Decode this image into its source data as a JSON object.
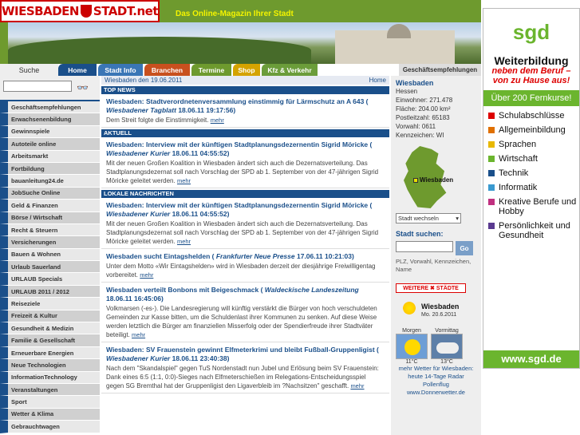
{
  "header": {
    "logo_left": "WIESBADEN",
    "logo_right": "STADT.net",
    "tagline": "Das Online-Magazin Ihrer Stadt"
  },
  "nav": {
    "search_label": "Suche",
    "tabs": [
      {
        "label": "Home",
        "color": "#1a4f8a"
      },
      {
        "label": "Stadt Info",
        "color": "#3a76b6"
      },
      {
        "label": "Branchen",
        "color": "#c8501e"
      },
      {
        "label": "Termine",
        "color": "#6e9a2e"
      },
      {
        "label": "Shop",
        "color": "#d4a300"
      },
      {
        "label": "Kfz & Verkehr",
        "color": "#6b9d3a"
      }
    ],
    "geschaeft": "Geschäftsempfehlungen"
  },
  "sidebar": {
    "search_placeholder": "",
    "items": [
      "Geschäftsempfehlungen",
      "Erwachsenenbildung",
      "Gewinnspiele",
      "Autoteile online",
      "Arbeitsmarkt",
      "Fortbildung",
      "bauanleitung24.de",
      "JobSuche Online",
      "Geld & Finanzen",
      "Börse / Wirtschaft",
      "Recht & Steuern",
      "Versicherungen",
      "Bauen & Wohnen",
      "Urlaub Sauerland",
      "URLAUB Specials",
      "URLAUB 2011 / 2012",
      "Reiseziele",
      "Freizeit & Kultur",
      "Gesundheit & Medizin",
      "Familie & Gesellschaft",
      "Erneuerbare Energien",
      "Neue Technologien",
      "InformationTechnology",
      "Veranstaltungen",
      "Sport",
      "Wetter & Klima",
      "Gebrauchtwagen"
    ]
  },
  "main": {
    "date": "Wiesbaden den 19.06.2011",
    "home_link": "Home",
    "more": "mehr",
    "sections": [
      {
        "title": "TOP NEWS",
        "articles": [
          {
            "head": "Wiesbaden: Stadtverordnetenversammlung einstimmig für Lärmschutz an A 643 (",
            "src": "Wiesbadener Tagblatt",
            "date": "18.06.11 19:17:56)",
            "text": "Dem Streit folgte die Einstimmigkeit."
          }
        ]
      },
      {
        "title": "AKTUELL",
        "articles": [
          {
            "head": "Wiesbaden: Interview mit der künftigen Stadtplanungsdezernentin Sigrid Möricke (",
            "src": "Wiesbadener Kurier",
            "date": "18.06.11 04:55:52)",
            "text": "Mit der neuen Großen Koalition in Wiesbaden ändert sich auch die Dezernatsverteilung. Das Stadtplanungsdezernat soll nach Vorschlag der SPD ab 1. September von der 47-jährigen Sigrid Möricke geleitet werden."
          }
        ]
      },
      {
        "title": "LOKALE NACHRICHTEN",
        "articles": [
          {
            "head": "Wiesbaden: Interview mit der künftigen Stadtplanungsdezernentin Sigrid Möricke (",
            "src": "Wiesbadener Kurier",
            "date": "18.06.11 04:55:52)",
            "text": "Mit der neuen Großen Koalition in Wiesbaden ändert sich auch die Dezernatsverteilung. Das Stadtplanungsdezernat soll nach Vorschlag der SPD ab 1. September von der 47-jährigen Sigrid Möricke geleitet werden."
          },
          {
            "head": "Wiesbaden sucht Eintagshelden (",
            "src": "Frankfurter Neue Presse",
            "date": "17.06.11 10:21:03)",
            "text": "Unter dem Motto «Wir Eintagshelden» wird in Wiesbaden derzeit der diesjährige Freiwilligentag vorbereitet."
          },
          {
            "head": "Wiesbaden verteilt Bonbons mit Beigeschmack (",
            "src": "Waldeckische Landeszeitung",
            "date": "18.06.11 16:45:06)",
            "text": "Volkmarsen (-es-). Die Landesregierung will künftig verstärkt die Bürger von hoch verschuldeten Gemeinden zur Kasse bitten, um die Schuldenlast ihrer Kommunen zu senken. Auf diese Weise werden letztlich die Bürger am finanziellen Misserfolg oder der Spendierfreude ihrer Stadtväter beteiligt."
          },
          {
            "head": "Wiesbaden: SV Frauenstein gewinnt Elfmeterkrimi und bleibt Fußball-Gruppenligist (",
            "src": "Wiesbadener Kurier",
            "date": "18.06.11 23:40:38)",
            "text": "Nach dem \"Skandalspiel\" gegen TuS Nordenstadt nun Jubel und Erlösung beim SV Frauenstein: Dank eines 6:5 (1:1, 0:0)-Sieges nach Elfmeterschießen im Relegations-Entscheidungsspiel gegen SG Bremthal hat der Gruppenligist den Ligaverbleib im ?Nachsitzen\" geschafft."
          }
        ]
      }
    ]
  },
  "info": {
    "city": "Wiesbaden",
    "rows": [
      "Hessen",
      "Einwohner: 271.478",
      "Fläche: 204.00 km²",
      "Postleitzahl: 65183",
      "Vorwahl: 0611",
      "Kennzeichen: WI"
    ],
    "map_label": "Wiesbaden",
    "switch": "Stadt wechseln",
    "search_title": "Stadt suchen:",
    "go": "Go",
    "hint": "PLZ, Vorwahl, Kennzeichen, Name",
    "weather_btn": "WEITERE ✖ STÄDTE",
    "weather_city": "Wiesbaden",
    "weather_date": "Mo. 20.6.2011",
    "morgen": "Morgen",
    "vormittag": "Vormittag",
    "t1": "11°C",
    "t2": "13°C",
    "more_weather": "mehr Wetter für Wiesbaden:",
    "links1": "heute  14-Tage  Radar",
    "links2": "Pollenflug",
    "links3": "www.Donnerwetter.de"
  },
  "ad": {
    "brand": "sgd",
    "l1": "Weiterbildung",
    "l2": "neben dem Beruf –",
    "l3": "von zu Hause aus!",
    "fern": "Über 200 Fernkurse!",
    "items": [
      {
        "label": "Schulabschlüsse",
        "color": "#d00"
      },
      {
        "label": "Allgemeinbildung",
        "color": "#e07000"
      },
      {
        "label": "Sprachen",
        "color": "#e8b800"
      },
      {
        "label": "Wirtschaft",
        "color": "#6bb52e"
      },
      {
        "label": "Technik",
        "color": "#1a4f8a"
      },
      {
        "label": "Informatik",
        "color": "#3a9ad0"
      },
      {
        "label": "Kreative Berufe und Hobby",
        "color": "#c03080"
      },
      {
        "label": "Persönlichkeit und Gesundheit",
        "color": "#5a3a90"
      }
    ],
    "url": "www.sgd.de"
  }
}
